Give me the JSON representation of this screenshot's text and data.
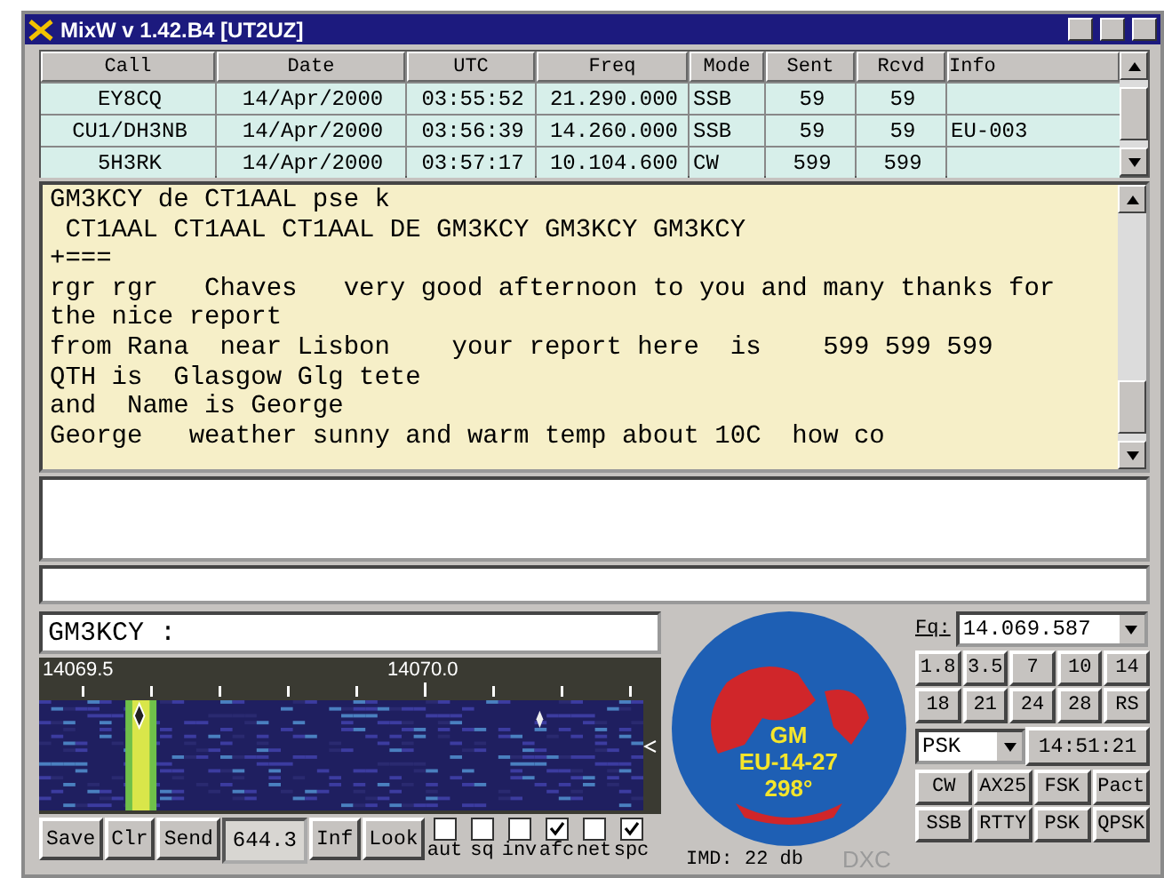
{
  "window": {
    "title": "MixW v 1.42.B4 [UT2UZ]"
  },
  "log": {
    "columns": [
      "Call",
      "Date",
      "UTC",
      "Freq",
      "Mode",
      "Sent",
      "Rcvd",
      "Info"
    ],
    "rows": [
      [
        "EY8CQ",
        "14/Apr/2000",
        "03:55:52",
        "21.290.000",
        "SSB",
        "59",
        "59",
        ""
      ],
      [
        "CU1/DH3NB",
        "14/Apr/2000",
        "03:56:39",
        "14.260.000",
        "SSB",
        "59",
        "59",
        "EU-003"
      ],
      [
        "5H3RK",
        "14/Apr/2000",
        "03:57:17",
        "10.104.600",
        "CW",
        "599",
        "599",
        ""
      ]
    ]
  },
  "receive_text": [
    "GM3KCY de CT1AAL pse k",
    " CT1AAL CT1AAL CT1AAL DE GM3KCY GM3KCY GM3KCY",
    "+===",
    "rgr rgr   Chaves   very good afternoon to you and many thanks for",
    "the nice report",
    "from Rana  near Lisbon    your report here  is    599 599 599",
    "QTH is  Glasgow Glg tete",
    "and  Name is George",
    "George   weather sunny and warm temp about 10C  how co"
  ],
  "call_field": {
    "value": "GM3KCY :"
  },
  "waterfall": {
    "scale_labels": [
      "14069.5",
      "14070.0"
    ]
  },
  "controls": {
    "buttons": [
      "Save",
      "Clr",
      "Send"
    ],
    "frequency": "644.3",
    "buttons_2": [
      "Inf",
      "Look"
    ],
    "options": [
      {
        "label": "aut",
        "checked": false
      },
      {
        "label": "sq",
        "checked": false
      },
      {
        "label": "inv",
        "checked": false
      },
      {
        "label": "afc",
        "checked": true
      },
      {
        "label": "net",
        "checked": false
      },
      {
        "label": "spc",
        "checked": true
      }
    ]
  },
  "map": {
    "lines": [
      "GM",
      "EU-14-27",
      "298°"
    ],
    "imd": "IMD: 22 db",
    "dxc": "DXC"
  },
  "radio": {
    "fq_label": "Fq:",
    "fq_value": "14.069.587",
    "bands": [
      "1.8",
      "3.5",
      "7",
      "10",
      "14",
      "18",
      "21",
      "24",
      "28",
      "RS"
    ],
    "mode_select": "PSK",
    "clock": "14:51:21",
    "modes": [
      "CW",
      "AX25",
      "FSK",
      "Pact",
      "SSB",
      "RTTY",
      "PSK",
      "QPSK"
    ]
  }
}
